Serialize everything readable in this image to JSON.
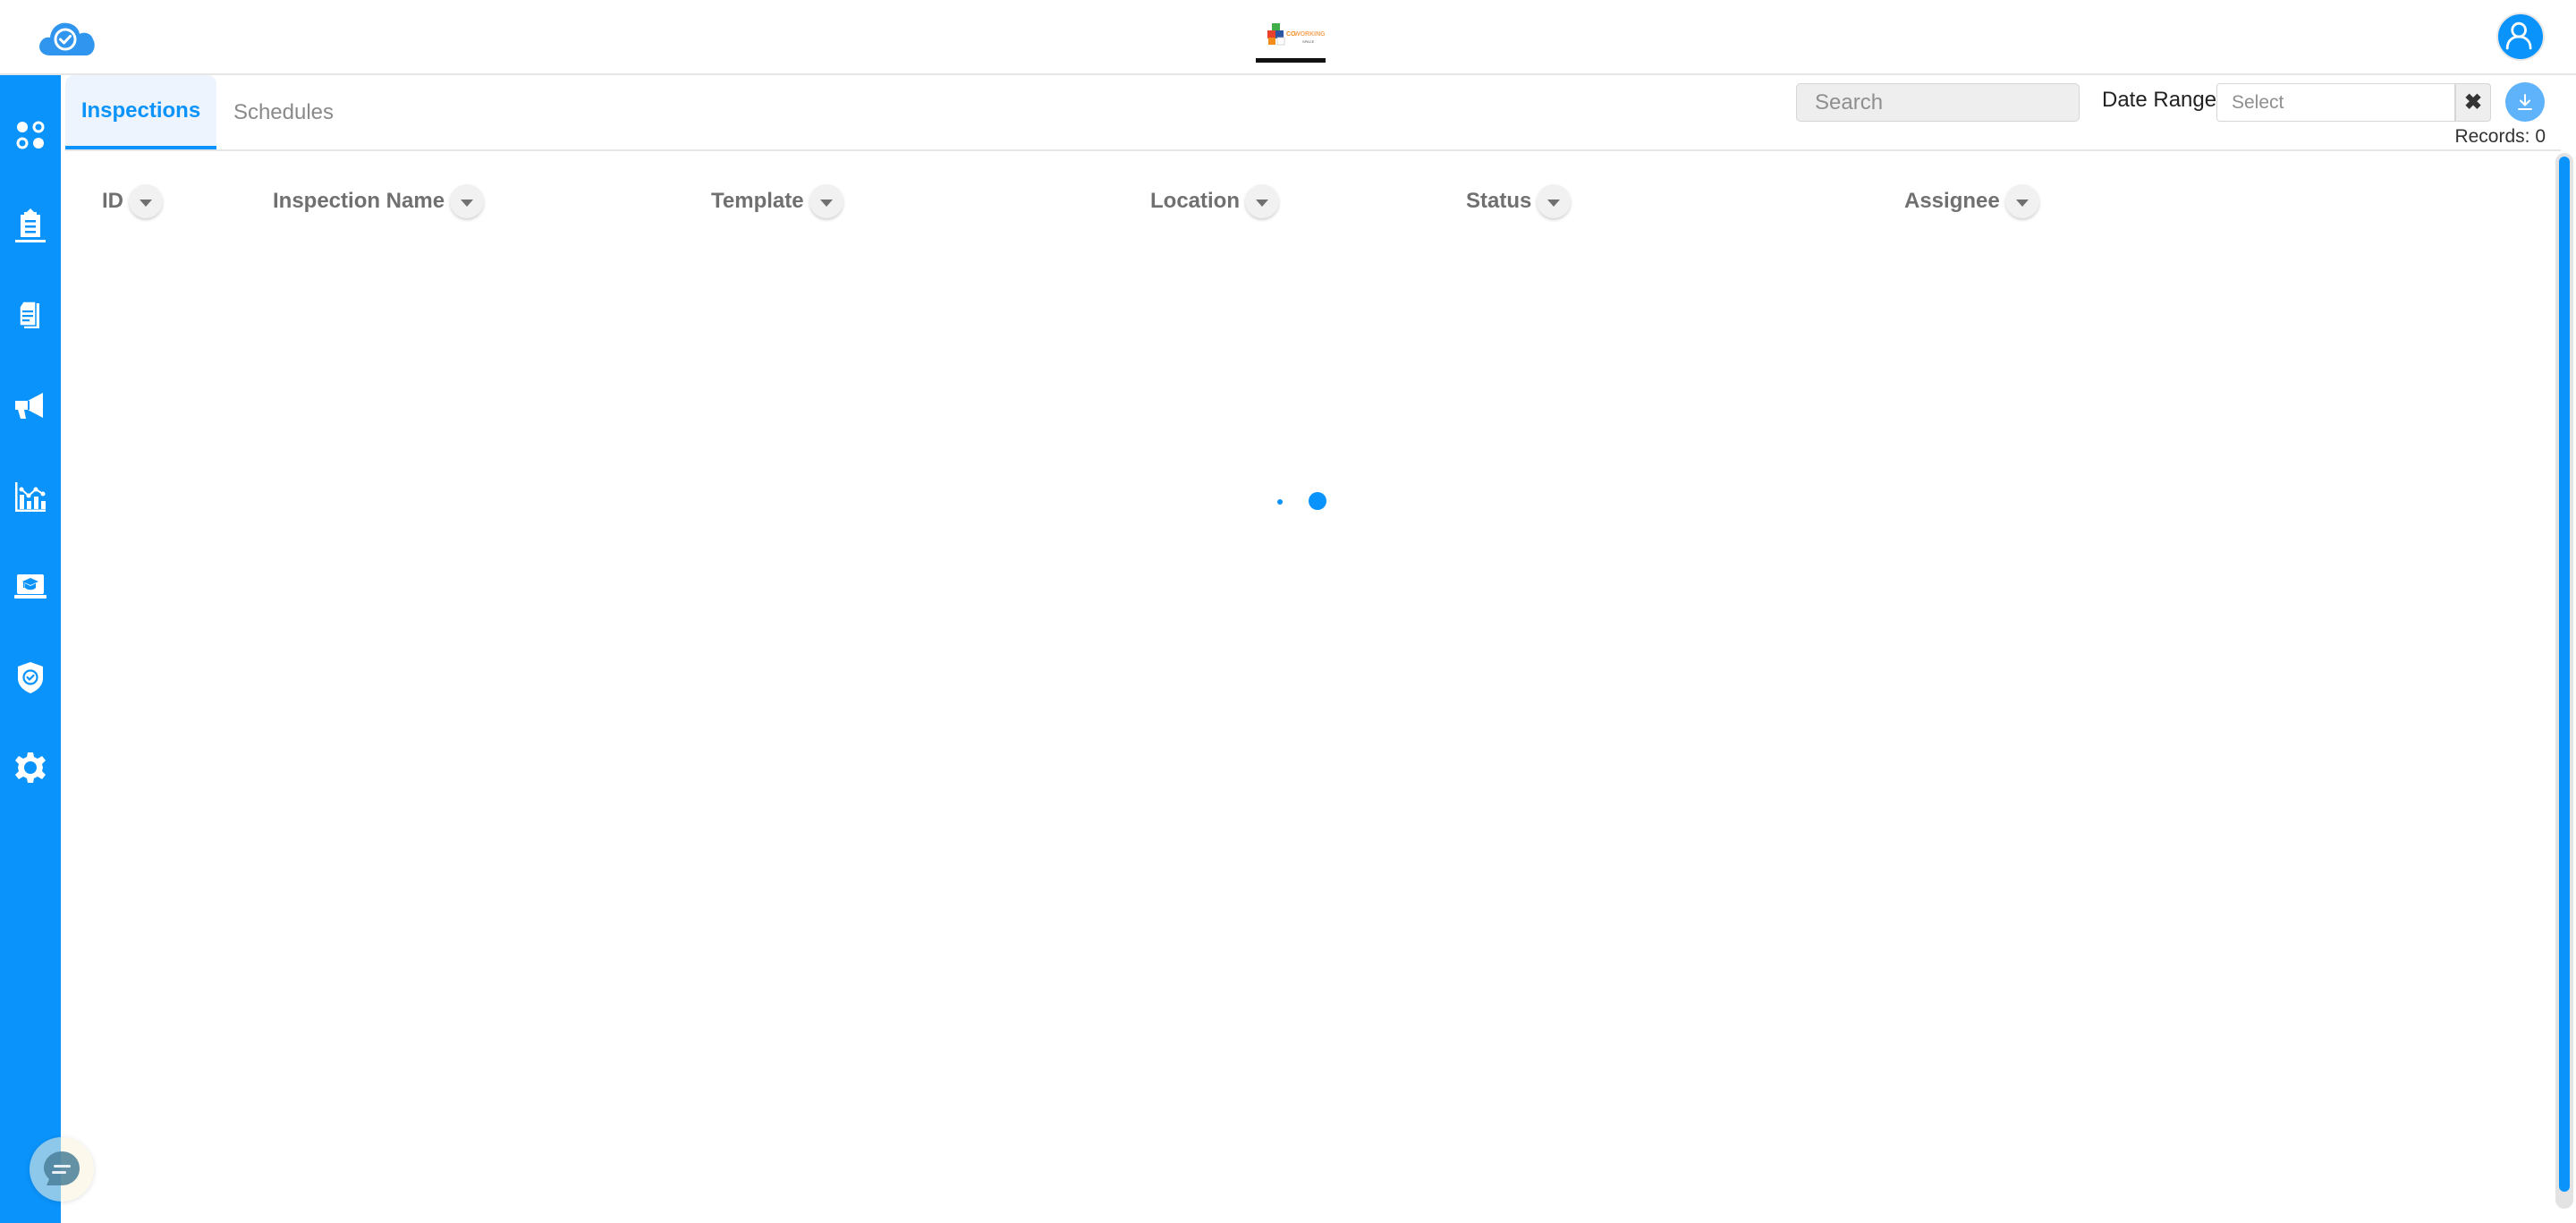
{
  "header": {
    "brand_icon": "cloud-check-icon",
    "company_logo_text": "COWORKING SPACE",
    "profile_icon": "user-icon"
  },
  "sidebar": {
    "items": [
      {
        "icon": "apps-dots-icon",
        "label": "Dashboard",
        "active": false
      },
      {
        "icon": "clipboard-icon",
        "label": "Inspections",
        "active": true
      },
      {
        "icon": "documents-icon",
        "label": "Documents",
        "active": false
      },
      {
        "icon": "megaphone-icon",
        "label": "Announcements",
        "active": false
      },
      {
        "icon": "analytics-chart-icon",
        "label": "Reports",
        "active": false
      },
      {
        "icon": "training-laptop-icon",
        "label": "Training",
        "active": false
      },
      {
        "icon": "shield-check-icon",
        "label": "Compliance",
        "active": false
      },
      {
        "icon": "gear-icon",
        "label": "Settings",
        "active": false
      }
    ]
  },
  "tabs": [
    {
      "label": "Inspections",
      "active": true
    },
    {
      "label": "Schedules",
      "active": false
    }
  ],
  "toolbar": {
    "search_placeholder": "Search",
    "search_value": "",
    "date_range_label": "Date Range",
    "date_range_placeholder": "Select",
    "date_range_value": "",
    "clear_icon": "✖",
    "download_icon": "download-icon",
    "records_label": "Records: 0"
  },
  "table": {
    "columns": [
      "ID",
      "Inspection Name",
      "Template",
      "Location",
      "Status",
      "Assignee"
    ],
    "rows": [],
    "loading": true
  },
  "chat": {
    "icon": "chat-bubble-icon"
  },
  "colors": {
    "primary": "#0a93fb",
    "active_tab_bg": "#eef4fd",
    "download_button": "#5eb3fb",
    "header_text": "#707070"
  }
}
